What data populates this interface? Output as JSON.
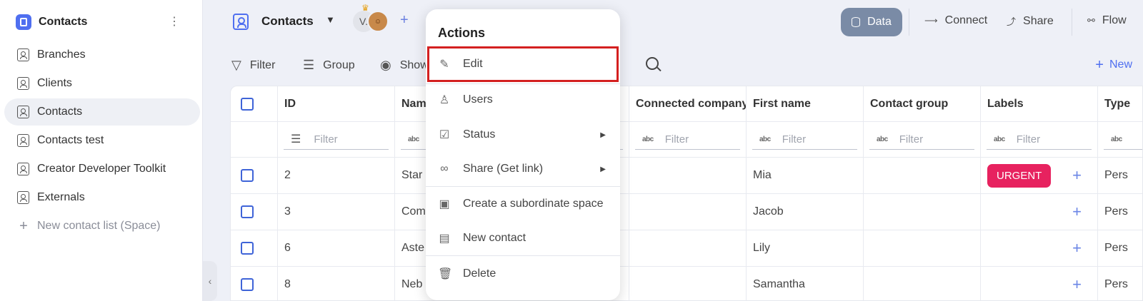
{
  "sidebar": {
    "title": "Contacts",
    "more_glyph": "⋮",
    "items": [
      {
        "label": "Branches"
      },
      {
        "label": "Clients"
      },
      {
        "label": "Contacts"
      },
      {
        "label": "Contacts test"
      },
      {
        "label": "Creator Developer Toolkit"
      },
      {
        "label": "Externals"
      }
    ],
    "add_label": "New contact list (Space)"
  },
  "header": {
    "title": "Contacts",
    "avatar_initial": "V.",
    "data_label": "Data",
    "connect_label": "Connect",
    "share_label": "Share",
    "flow_label": "Flow"
  },
  "toolbar": {
    "filter_label": "Filter",
    "group_label": "Group",
    "show_label": "Show",
    "new_label": "New"
  },
  "grid": {
    "columns": [
      "ID",
      "Name",
      "Connected company",
      "First name",
      "Contact group",
      "Labels",
      "Type"
    ],
    "filter_placeholder": "Filter",
    "rows": [
      {
        "id": "2",
        "name": "Star",
        "first_name": "Mia",
        "label": "URGENT",
        "type": "Pers"
      },
      {
        "id": "3",
        "name": "Com",
        "first_name": "Jacob",
        "label": "",
        "type": "Pers"
      },
      {
        "id": "6",
        "name": "Aste",
        "first_name": "Lily",
        "label": "",
        "type": "Pers"
      },
      {
        "id": "8",
        "name": "Neb",
        "first_name": "Samantha",
        "label": "",
        "type": "Pers"
      }
    ]
  },
  "menu": {
    "title": "Actions",
    "items": {
      "edit": "Edit",
      "users": "Users",
      "status": "Status",
      "share": "Share (Get link)",
      "subordinate": "Create a subordinate space",
      "new_contact": "New contact",
      "delete": "Delete"
    }
  },
  "colors": {
    "accent": "#4f6ff0",
    "urgent": "#e7225f",
    "data_button": "#7a8ba6",
    "highlight_border": "#d42020"
  }
}
